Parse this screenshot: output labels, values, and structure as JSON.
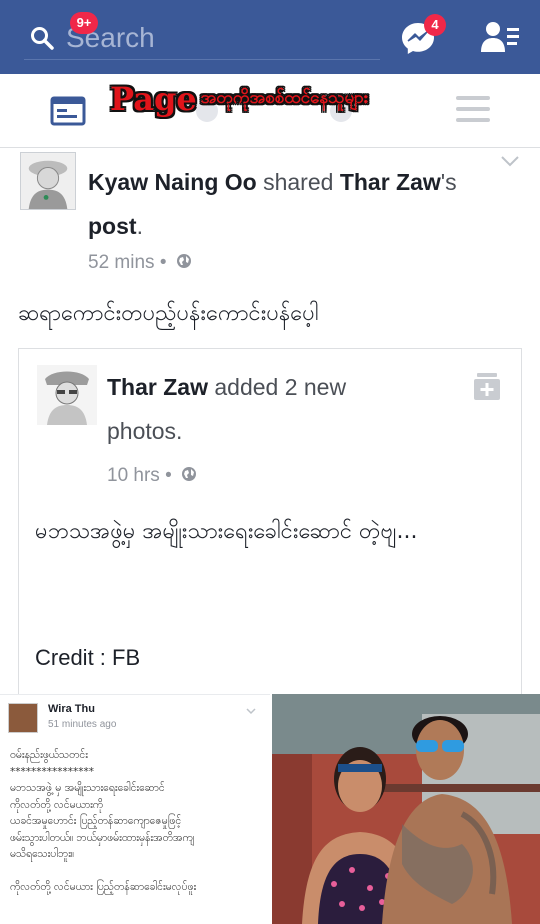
{
  "topbar": {
    "search_placeholder": "Search",
    "messages_badge": "4"
  },
  "nav": {
    "news_badge": "9+",
    "overlay_word": "Page",
    "overlay_mm": "အတုကိုအစစ်ထင်နေသူများ"
  },
  "post": {
    "author": "Kyaw Naing Oo",
    "action": " shared ",
    "source_name": "Thar Zaw",
    "source_suffix": "'s ",
    "post_word": "post",
    "period": ".",
    "time": "52 mins",
    "dot": "•",
    "body": "ဆရာကောင်းတပည့်ပန်းကောင်းပန်ပေ့ါ"
  },
  "card": {
    "author": "Thar Zaw",
    "action": " added 2 new photos.",
    "time": "10 hrs",
    "dot": "•",
    "text": "မဘသအဖွဲ့မှ အမျိုးသားရေးခေါင်းဆောင် တဲ့ဗျ...",
    "credit": "Credit : FB"
  },
  "shot": {
    "name": "Wira Thu",
    "time": "51 minutes ago",
    "lines": [
      "ဝမ်းနည်းဖွယ်သတင်း",
      "****************",
      "မဘသအဖွဲ့ မှ အမျိုးသားရေးခေါင်းဆောင်",
      "ကိုလတ်တို့ လင်မယားကို",
      "ယခင်အမှုဟောင်း ပြည့်တန်ဆာကျောဇေမှုဖြင့်",
      "ဖမ်းသွားပါတယ်။ ဘယ်မှာဖမ်းထားမှန်းအတိအကျ",
      "မသိရသေးပါဘူး။",
      "",
      "ကိုလတ်တို့ လင်မယား ပြည့်တန်ဆာခေါင်းမလုပ်ဖူး"
    ]
  },
  "colors": {
    "brand": "#3b5998",
    "badge": "#f02849",
    "overlay_text": "#e0141a"
  },
  "icons": [
    "search-icon",
    "messenger-icon",
    "friend-requests-icon",
    "news-feed-icon",
    "menu-icon",
    "globe-icon",
    "chevron-down-icon",
    "save-icon"
  ]
}
